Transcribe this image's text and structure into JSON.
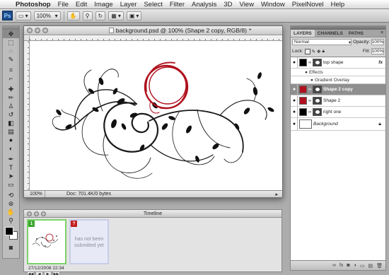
{
  "menubar": {
    "apple": "",
    "app": "Photoshop",
    "items": [
      "File",
      "Edit",
      "Image",
      "Layer",
      "Select",
      "Filter",
      "Analysis",
      "3D",
      "View",
      "Window",
      "PixelNovel",
      "Help"
    ]
  },
  "options": {
    "logo": "Ps",
    "zoom": "100%",
    "buttons": [
      "home-icon",
      "zoom-select",
      "hand-icon",
      "zoom-icon",
      "rotate-icon",
      "arrange-icon",
      "screen-mode-icon"
    ]
  },
  "document": {
    "title": "background.psd @ 100% (Shape 2 copy, RGB/8)",
    "zoom": "100%",
    "info": "Doc: 701.4K/0 bytes",
    "accent_red": "#b0101e"
  },
  "layers_panel": {
    "tabs": [
      "LAYERS",
      "CHANNELS",
      "PATHS"
    ],
    "blend_mode": "Normal",
    "opacity_label": "Opacity:",
    "opacity": "100%",
    "lock_label": "Lock:",
    "fill_label": "Fill:",
    "fill": "100%",
    "layers": [
      {
        "name": "top shape",
        "fx": "fx",
        "color": "#000000"
      },
      {
        "name": "Effects"
      },
      {
        "name": "Gradient Overlay"
      },
      {
        "name": "Shape 2 copy",
        "color": "#b0101e"
      },
      {
        "name": "Shape 2",
        "color": "#b0101e"
      },
      {
        "name": "right one",
        "color": "#000000"
      },
      {
        "name": "Background",
        "color": "#ffffff"
      }
    ]
  },
  "timeline": {
    "title": "Timeline",
    "frames": [
      {
        "badge": "1"
      },
      {
        "badge": "?",
        "note": "has not been submitted yet"
      }
    ],
    "timestamp": "27/12/2008 22:34"
  }
}
